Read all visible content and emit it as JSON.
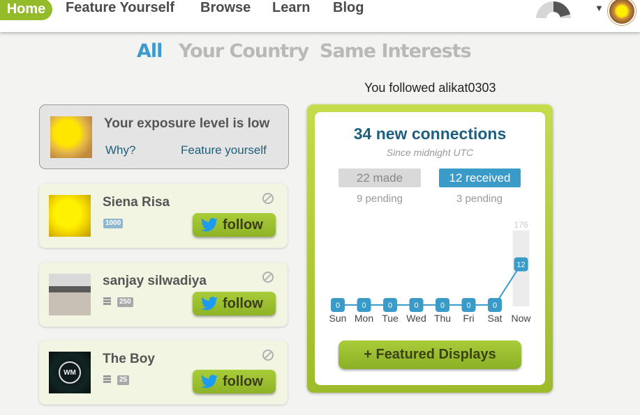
{
  "nav": {
    "home": "Home",
    "feature_yourself": "Feature Yourself",
    "browse": "Browse",
    "learn": "Learn",
    "blog": "Blog",
    "menu_caret": "▼"
  },
  "tabs": {
    "all": "All",
    "your_country": "Your Country",
    "same_interests": "Same Interests"
  },
  "notice": "You followed alikat0303",
  "exposure": {
    "title": "Your exposure level is low",
    "why": "Why?",
    "feature": "Feature yourself"
  },
  "users": [
    {
      "name": "Siena Risa",
      "score": "1000",
      "follow": "follow"
    },
    {
      "name": "sanjay silwadiya",
      "score": "250",
      "follow": "follow"
    },
    {
      "name": "The Boy",
      "score": "25",
      "follow": "follow",
      "avatar_text": "WM"
    }
  ],
  "connections": {
    "title": "34 new connections",
    "subtitle": "Since midnight UTC",
    "made": "22 made",
    "received": "12 received",
    "made_pending": "9 pending",
    "received_pending": "3 pending",
    "featured_button": "+ Featured Displays"
  },
  "colors": {
    "brand_green": "#94bc2a",
    "accent_blue": "#3a9ac8",
    "title_blue": "#1f5e7e"
  },
  "chart_data": {
    "type": "line",
    "categories": [
      "Sun",
      "Mon",
      "Tue",
      "Wed",
      "Thu",
      "Fri",
      "Sat",
      "Now"
    ],
    "values": [
      0,
      0,
      0,
      0,
      0,
      0,
      0,
      12
    ],
    "max_label": "176",
    "max_value": 176
  }
}
